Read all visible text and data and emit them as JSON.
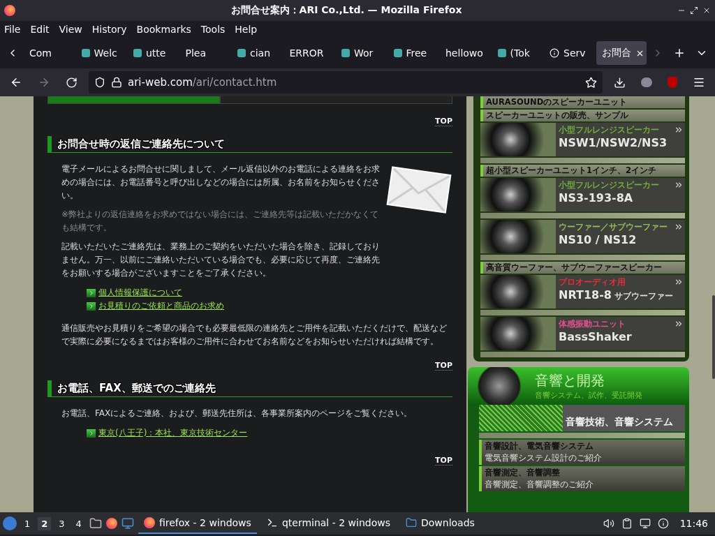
{
  "window": {
    "title": "お問合せ案内：ARI Co.,Ltd. — Mozilla Firefox"
  },
  "menu": [
    "File",
    "Edit",
    "View",
    "History",
    "Bookmarks",
    "Tools",
    "Help"
  ],
  "tabs": [
    {
      "label": "Com",
      "kind": "plain",
      "selected": false
    },
    {
      "label": "Welc",
      "kind": "icon",
      "selected": false
    },
    {
      "label": "utte",
      "kind": "icon",
      "selected": false
    },
    {
      "label": "Plea",
      "kind": "plain",
      "selected": false
    },
    {
      "label": "cian",
      "kind": "icon",
      "selected": false
    },
    {
      "label": "ERROR",
      "kind": "plain",
      "selected": false
    },
    {
      "label": "Wor",
      "kind": "icon",
      "selected": false
    },
    {
      "label": "Free",
      "kind": "icon",
      "selected": false
    },
    {
      "label": "hellowo",
      "kind": "plain",
      "selected": false
    },
    {
      "label": "(Tok",
      "kind": "icon",
      "selected": false
    },
    {
      "label": "Serv",
      "kind": "info",
      "selected": false
    },
    {
      "label": "お問合",
      "kind": "plain",
      "selected": true
    }
  ],
  "url": {
    "host": "ari-web.com",
    "path": "/ari/contact.htm"
  },
  "content": {
    "top_links": [
      "TOP",
      "TOP",
      "TOP"
    ],
    "sections": [
      {
        "heading": "お問合せ時の返信ご連絡先について",
        "envelope": true,
        "paragraphs": [
          {
            "kind": "normal",
            "text": "電子メールによるお問合せに関しまして、メール返信以外のお電話による連絡をお求めの場合には、お電話番号と呼び出しなどの場合には所属、お名前をお知らせください。"
          },
          {
            "kind": "note",
            "text": "※弊社よりの返信連絡をお求めではない場合には、ご連絡先等は記載いただかなくても結構です。"
          },
          {
            "kind": "normal",
            "text": "記載いただいたご連絡先は、業務上のご契約をいただいた場合を除き、記録しておりません。万一、以前にご連絡いただいている場合でも、必要に応じて再度、ご連絡先をお願いする場合がございますことをご了承ください。"
          }
        ],
        "links": [
          "個人情報保護について",
          "お見積りのご依頼と商品のお求め"
        ],
        "after": "通信販売やお見積りをご希望の場合でも必要最低限の連絡先とご用件を記載いただくだけで、配送などで実際に必要になるまではお客様のご用件に合わせてお名前などをお知らせいただければ結構です。"
      },
      {
        "heading": "お電話、FAX、郵送でのご連絡先",
        "envelope": false,
        "paragraphs": [
          {
            "kind": "normal",
            "text": "お電話、FAXによるご連絡、および、郵送先住所は、各事業所案内のページをご覧ください。"
          }
        ],
        "links": [
          "東京(八王子)：本社、東京技術センター"
        ]
      }
    ]
  },
  "sidebar": {
    "items": [
      {
        "kind": "heading",
        "text": "AURASOUNDのスピーカーユニット"
      },
      {
        "kind": "heading",
        "text": "スピーカーユニットの販売、サンプル"
      },
      {
        "kind": "product",
        "category": "小型フルレンジスピーカー",
        "color": "#6fae3c",
        "model": "NSW1/NSW2/NS3"
      },
      {
        "kind": "heading",
        "text": "超小型スピーカーユニット1インチ、2インチ"
      },
      {
        "kind": "product",
        "category": "小型フルレンジスピーカー",
        "color": "#6fae3c",
        "model": "NS3-193-8A"
      },
      {
        "kind": "product",
        "category": "ウーファー／サブウーファー",
        "color": "#8fbf5a",
        "model": "NS10 / NS12"
      },
      {
        "kind": "heading",
        "text": "高音質ウーファー、サブウーファースピーカー"
      },
      {
        "kind": "product",
        "category": "プロオーディオ用",
        "color": "#e0303a",
        "model": "NRT18-8",
        "suffix": "サブウーファー"
      },
      {
        "kind": "product",
        "category": "体感振動ユニット",
        "color": "#e05090",
        "model": "BassShaker"
      }
    ],
    "banner": {
      "title": "音響と開発",
      "subtitle": "音響システム、試作、受託開発"
    },
    "feature": {
      "model": "音響技術、音響システム"
    },
    "entries": [
      {
        "title": "音響設計、電気音響システム",
        "subtitle": "電気音響システム設計のご紹介"
      },
      {
        "title": "音響測定、音響調整",
        "subtitle": "音響測定、音響調整のご紹介"
      }
    ]
  },
  "taskbar": {
    "workspaces": [
      {
        "label": "1",
        "selected": false
      },
      {
        "label": "2",
        "selected": true
      },
      {
        "label": "3",
        "selected": false
      },
      {
        "label": "4",
        "selected": false
      }
    ],
    "tasks": [
      {
        "label": "firefox - 2 windows",
        "kind": "browser",
        "selected": true
      },
      {
        "label": "qterminal - 2 windows",
        "kind": "terminal",
        "selected": false
      },
      {
        "label": "Downloads",
        "kind": "folder",
        "selected": false
      }
    ],
    "clock": "11:46"
  }
}
